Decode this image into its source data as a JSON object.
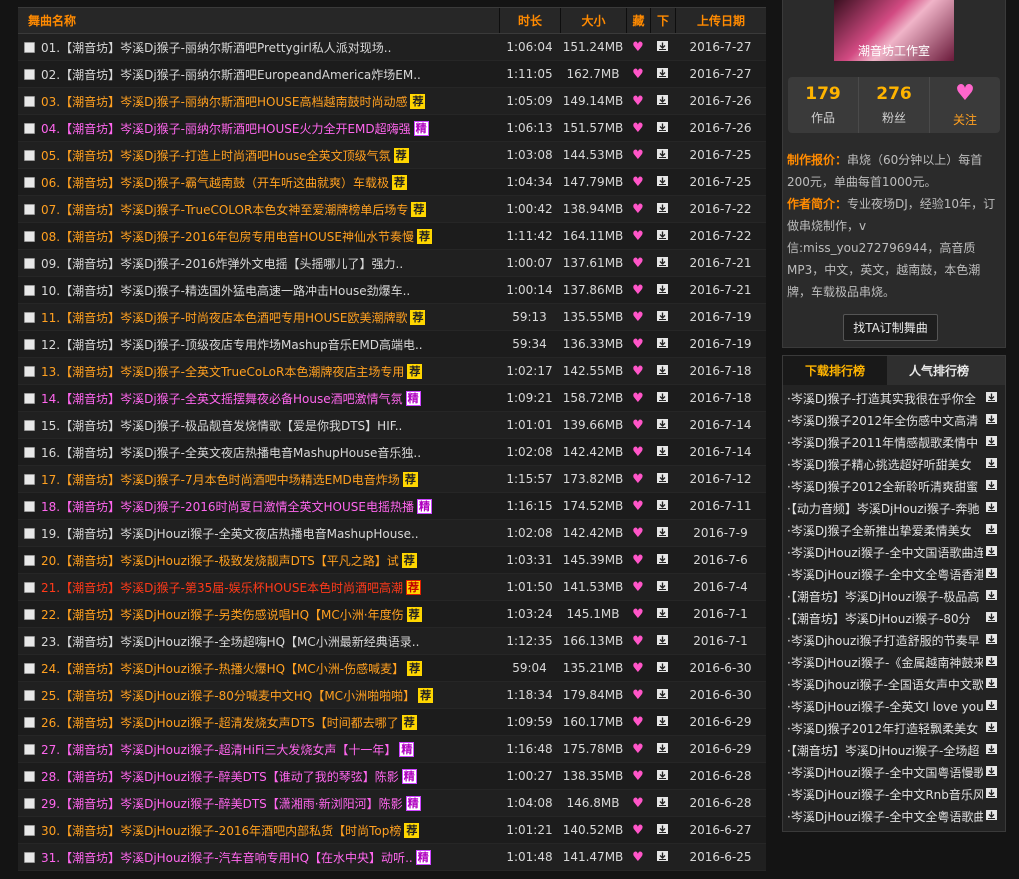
{
  "table": {
    "headers": {
      "name": "舞曲名称",
      "time": "时长",
      "size": "大小",
      "fav": "藏",
      "dl": "下",
      "date": "上传日期"
    },
    "rows": [
      {
        "name": "01.【潮音坊】岑溪Dj猴子-丽纳尔斯酒吧Prettygirl私人派对现场..",
        "time": "1:06:04",
        "size": "151.24MB",
        "date": "2016-7-27",
        "color": "normal",
        "badge": ""
      },
      {
        "name": "02.【潮音坊】岑溪Dj猴子-丽纳尔斯酒吧EuropeandAmerica炸场EM..",
        "time": "1:11:05",
        "size": "162.7MB",
        "date": "2016-7-27",
        "color": "normal",
        "badge": ""
      },
      {
        "name": "03.【潮音坊】岑溪Dj猴子-丽纳尔斯酒吧HOUSE高档越南鼓时尚动感",
        "time": "1:05:09",
        "size": "149.14MB",
        "date": "2016-7-26",
        "color": "orange",
        "badge": "荐"
      },
      {
        "name": "04.【潮音坊】岑溪Dj猴子-丽纳尔斯酒吧HOUSE火力全开EMD超嗨强",
        "time": "1:06:13",
        "size": "151.57MB",
        "date": "2016-7-26",
        "color": "pink",
        "badge": "精"
      },
      {
        "name": "05.【潮音坊】岑溪Dj猴子-打造上时尚酒吧House全英文顶级气氛",
        "time": "1:03:08",
        "size": "144.53MB",
        "date": "2016-7-25",
        "color": "orange",
        "badge": "荐"
      },
      {
        "name": "06.【潮音坊】岑溪Dj猴子-霸气越南鼓（开车听这曲就爽）车载极",
        "time": "1:04:34",
        "size": "147.79MB",
        "date": "2016-7-25",
        "color": "orange",
        "badge": "荐"
      },
      {
        "name": "07.【潮音坊】岑溪Dj猴子-TrueCOLOR本色女神至爱潮牌榜单后场专",
        "time": "1:00:42",
        "size": "138.94MB",
        "date": "2016-7-22",
        "color": "orange",
        "badge": "荐"
      },
      {
        "name": "08.【潮音坊】岑溪Dj猴子-2016年包房专用电音HOUSE神仙水节奏慢",
        "time": "1:11:42",
        "size": "164.11MB",
        "date": "2016-7-22",
        "color": "orange",
        "badge": "荐"
      },
      {
        "name": "09.【潮音坊】岑溪Dj猴子-2016炸弹外文电摇【头摇哪儿了】强力..",
        "time": "1:00:07",
        "size": "137.61MB",
        "date": "2016-7-21",
        "color": "normal",
        "badge": ""
      },
      {
        "name": "10.【潮音坊】岑溪Dj猴子-精选国外猛电高速一路冲击House劲爆车..",
        "time": "1:00:14",
        "size": "137.86MB",
        "date": "2016-7-21",
        "color": "normal",
        "badge": ""
      },
      {
        "name": "11.【潮音坊】岑溪Dj猴子-时尚夜店本色酒吧专用HOUSE欧美潮牌歌",
        "time": "59:13",
        "size": "135.55MB",
        "date": "2016-7-19",
        "color": "orange",
        "badge": "荐"
      },
      {
        "name": "12.【潮音坊】岑溪Dj猴子-顶级夜店专用炸场Mashup音乐EMD高端电..",
        "time": "59:34",
        "size": "136.33MB",
        "date": "2016-7-19",
        "color": "normal",
        "badge": ""
      },
      {
        "name": "13.【潮音坊】岑溪Dj猴子-全英文TrueCoLoR本色潮牌夜店主场专用",
        "time": "1:02:17",
        "size": "142.55MB",
        "date": "2016-7-18",
        "color": "orange",
        "badge": "荐"
      },
      {
        "name": "14.【潮音坊】岑溪Dj猴子-全英文摇摆舞夜必备House酒吧激情气氛",
        "time": "1:09:21",
        "size": "158.72MB",
        "date": "2016-7-18",
        "color": "pink",
        "badge": "精"
      },
      {
        "name": "15.【潮音坊】岑溪Dj猴子-极品靓音发烧情歌【爱是你我DTS】HIF..",
        "time": "1:01:01",
        "size": "139.66MB",
        "date": "2016-7-14",
        "color": "normal",
        "badge": ""
      },
      {
        "name": "16.【潮音坊】岑溪Dj猴子-全英文夜店热播电音MashupHouse音乐独..",
        "time": "1:02:08",
        "size": "142.42MB",
        "date": "2016-7-14",
        "color": "normal",
        "badge": ""
      },
      {
        "name": "17.【潮音坊】岑溪Dj猴子-7月本色时尚酒吧中场精选EMD电音炸场",
        "time": "1:15:57",
        "size": "173.82MB",
        "date": "2016-7-12",
        "color": "orange",
        "badge": "荐"
      },
      {
        "name": "18.【潮音坊】岑溪Dj猴子-2016时尚夏日激情全英文HOUSE电摇热播",
        "time": "1:16:15",
        "size": "174.52MB",
        "date": "2016-7-11",
        "color": "pink",
        "badge": "精"
      },
      {
        "name": "19.【潮音坊】岑溪DjHouzi猴子-全英文夜店热播电音MashupHouse..",
        "time": "1:02:08",
        "size": "142.42MB",
        "date": "2016-7-9",
        "color": "normal",
        "badge": ""
      },
      {
        "name": "20.【潮音坊】岑溪DjHouzi猴子-极致发烧靓声DTS【平凡之路】试",
        "time": "1:03:31",
        "size": "145.39MB",
        "date": "2016-7-6",
        "color": "orange",
        "badge": "荐"
      },
      {
        "name": "21.【潮音坊】岑溪Dj猴子-第35届-娱乐杯HOUSE本色时尚酒吧高潮",
        "time": "1:01:50",
        "size": "141.53MB",
        "date": "2016-7-4",
        "color": "red",
        "badge": "荐"
      },
      {
        "name": "22.【潮音坊】岑溪DjHouzi猴子-另类伤感说唱HQ【MC小洲·年度伤",
        "time": "1:03:24",
        "size": "145.1MB",
        "date": "2016-7-1",
        "color": "orange",
        "badge": "荐"
      },
      {
        "name": "23.【潮音坊】岑溪DjHouzi猴子-全场超嗨HQ【MC小洲最新经典语录..",
        "time": "1:12:35",
        "size": "166.13MB",
        "date": "2016-7-1",
        "color": "normal",
        "badge": ""
      },
      {
        "name": "24.【潮音坊】岑溪DjHouzi猴子-热播火爆HQ【MC小洲-伤感喊麦】",
        "time": "59:04",
        "size": "135.21MB",
        "date": "2016-6-30",
        "color": "orange",
        "badge": "荐"
      },
      {
        "name": "25.【潮音坊】岑溪DjHouzi猴子-80分喊麦中文HQ【MC小洲啪啪啪】",
        "time": "1:18:34",
        "size": "179.84MB",
        "date": "2016-6-30",
        "color": "orange",
        "badge": "荐"
      },
      {
        "name": "26.【潮音坊】岑溪DjHouzi猴子-超清发烧女声DTS【时间都去哪了",
        "time": "1:09:59",
        "size": "160.17MB",
        "date": "2016-6-29",
        "color": "orange",
        "badge": "荐"
      },
      {
        "name": "27.【潮音坊】岑溪DjHouzi猴子-超清HiFi三大发烧女声【十一年】",
        "time": "1:16:48",
        "size": "175.78MB",
        "date": "2016-6-29",
        "color": "pink",
        "badge": "精"
      },
      {
        "name": "28.【潮音坊】岑溪DjHouzi猴子-醉美DTS【谁动了我的琴弦】陈影",
        "time": "1:00:27",
        "size": "138.35MB",
        "date": "2016-6-28",
        "color": "pink",
        "badge": "精"
      },
      {
        "name": "29.【潮音坊】岑溪DjHouzi猴子-醉美DTS【潇湘雨·新浏阳河】陈影",
        "time": "1:04:08",
        "size": "146.8MB",
        "date": "2016-6-28",
        "color": "pink",
        "badge": "精"
      },
      {
        "name": "30.【潮音坊】岑溪DjHouzi猴子-2016年酒吧内部私货【时尚Top榜",
        "time": "1:01:21",
        "size": "140.52MB",
        "date": "2016-6-27",
        "color": "orange",
        "badge": "荐"
      },
      {
        "name": "31.【潮音坊】岑溪DjHouzi猴子-汽车音响专用HQ【在水中央】动听..",
        "time": "1:01:48",
        "size": "141.47MB",
        "date": "2016-6-25",
        "color": "pink",
        "badge": "精"
      }
    ]
  },
  "profile": {
    "avatar_caption": "潮音坊工作室",
    "works_count": "179",
    "works_label": "作品",
    "fans_count": "276",
    "fans_label": "粉丝",
    "follow_label": "关注",
    "price_label": "制作报价：",
    "price_text": "串烧（60分钟以上）每首200元，单曲每首1000元。",
    "intro_label": "作者简介：",
    "intro_text": "专业夜场DJ，经验10年，订做串烧制作，v信:miss_you272796944，高音质MP3，中文，英文，越南鼓，本色潮牌，车载极品串烧。",
    "order_button": "找TA订制舞曲"
  },
  "ranking": {
    "tabs": [
      "下载排行榜",
      "人气排行榜"
    ],
    "items": [
      "·岑溪DJ猴子-打造其实我很在乎你全",
      "·岑溪DJ猴子2012年全伤感中文高清",
      "·岑溪DJ猴子2011年情感靓歌柔情中",
      "·岑溪DJ猴子精心挑选超好听甜美女",
      "·岑溪DJ猴子2012全新聆听清爽甜蜜",
      "·【动力音频】岑溪DjHouzi猴子-奔驰",
      "·岑溪DJ猴子全新推出挚爱柔情美女",
      "·岑溪DjHouzi猴子-全中文国语歌曲连",
      "·岑溪DjHouzi猴子-全中文全粤语香港",
      "·【潮音坊】岑溪DjHouzi猴子-极品高",
      "·【潮音坊】岑溪DjHouzi猴子-80分",
      "·岑溪Djhouzi猴子打造舒服的节奏早",
      "·岑溪DjHouzi猴子-《金属越南神鼓来",
      "·岑溪Djhouzi猴子-全国语女声中文歌",
      "·岑溪DjHouzi猴子-全英文I love you",
      "·岑溪DJ猴子2012年打造轻飘柔美女",
      "·【潮音坊】岑溪DjHouzi猴子-全场超",
      "·岑溪DjHouzi猴子-全中文国粤语慢歌",
      "·岑溪DjHouzi猴子-全中文Rnb音乐风",
      "·岑溪DjHouzi猴子-全中文全粤语歌曲"
    ]
  },
  "colors": {
    "accent": "#ff8a00",
    "stat": "#ffb400",
    "pink": "#ff66ee",
    "orange": "#ffa020",
    "red": "#ff3a1a",
    "text": "#d8d8d8"
  },
  "icons": {
    "fav": "heart-icon",
    "dl": "download-icon",
    "badge_recommend": "荐",
    "badge_fine": "精"
  }
}
